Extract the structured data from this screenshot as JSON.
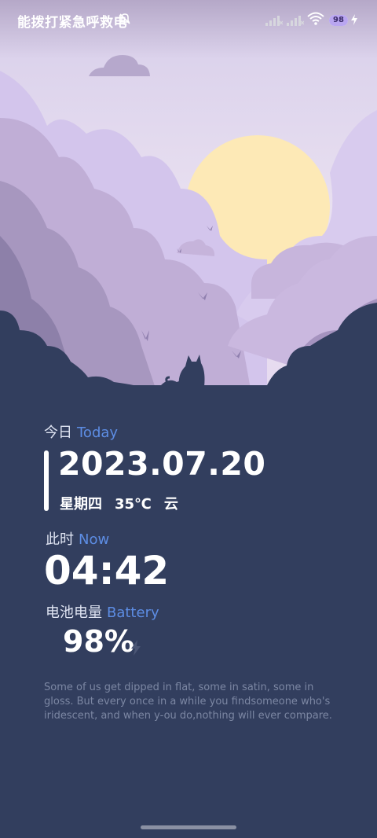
{
  "status_bar": {
    "carrier_text": "能拨打紧急呼救电",
    "battery_percent": "98",
    "battery_level": 0.98
  },
  "today": {
    "label_cn": "今日",
    "label_en": "Today"
  },
  "date": "2023.07.20",
  "weekday": "星期四",
  "temperature": "35℃",
  "weather": "云",
  "now": {
    "label_cn": "此时",
    "label_en": "Now"
  },
  "time": "04:42",
  "battery": {
    "label_cn": "电池电量",
    "label_en": "Battery",
    "value": "98%"
  },
  "quote": "Some of us get dipped in flat, some in satin, some in gloss. But every once in a while you findsomeone who's iridescent, and when y-ou do,nothing will ever compare.",
  "colors": {
    "background": "#323e5e",
    "accent": "#5d8de4",
    "sun": "#fde9b6"
  },
  "icons": [
    "bell-off-icon",
    "signal-icon",
    "wifi-icon",
    "battery-icon",
    "charging-bolt-icon"
  ]
}
